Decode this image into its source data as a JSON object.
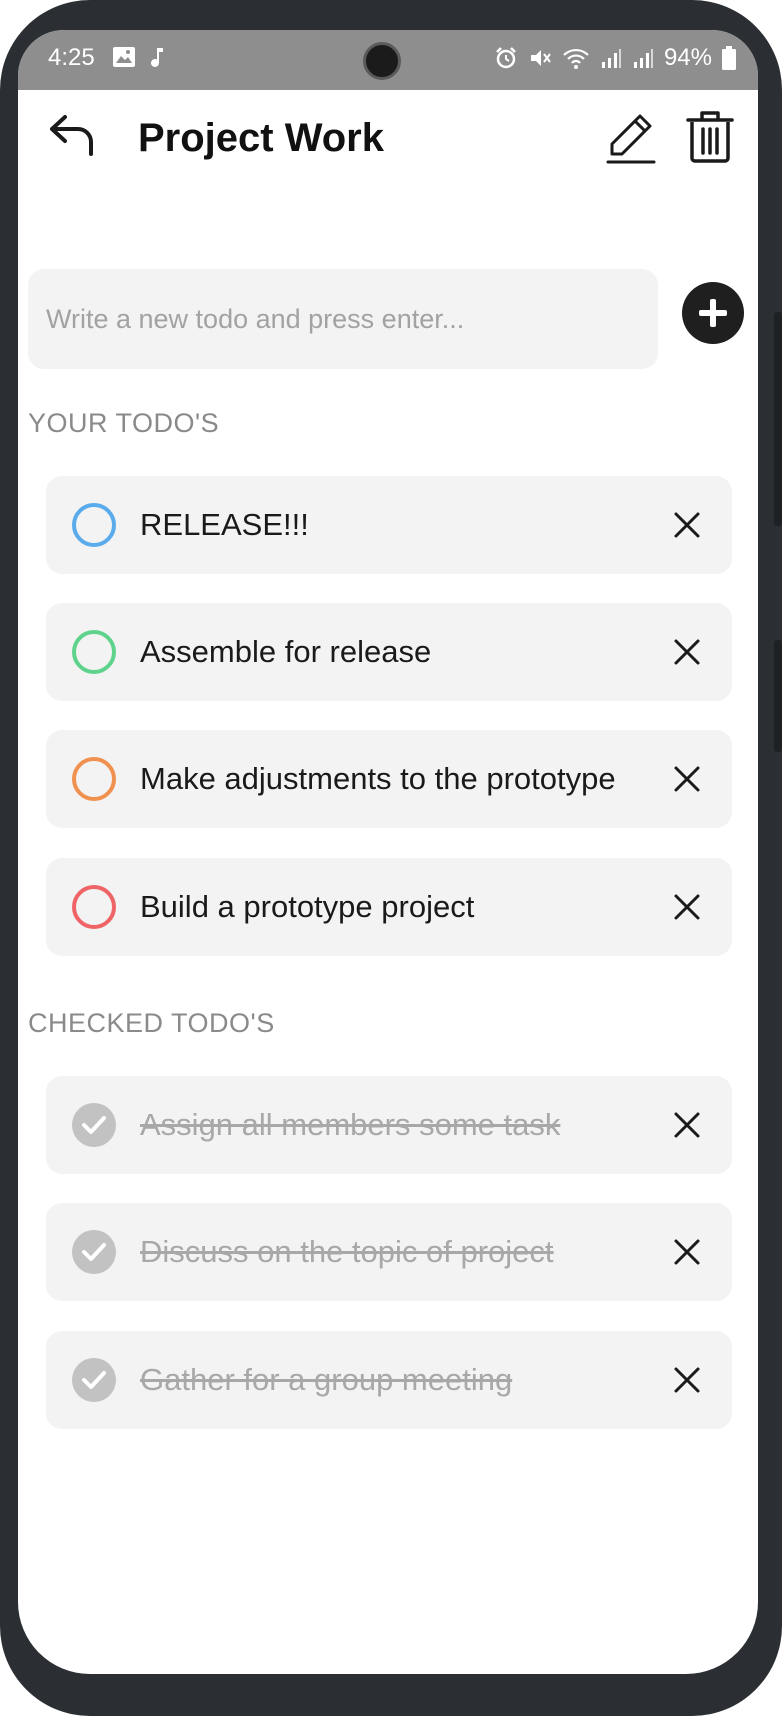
{
  "status_bar": {
    "time": "4:25",
    "battery": "94%"
  },
  "header": {
    "title": "Project Work"
  },
  "new_todo": {
    "placeholder": "Write a new todo and press enter..."
  },
  "sections": {
    "open_label": "YOUR TODO'S",
    "checked_label": "CHECKED TODO'S"
  },
  "open_todos": [
    {
      "text": "RELEASE!!!",
      "color": "#5aabec"
    },
    {
      "text": "Assemble for release",
      "color": "#5fd38c"
    },
    {
      "text": "Make adjustments to the prototype",
      "color": "#f09150"
    },
    {
      "text": "Build a prototype project",
      "color": "#ef6466"
    }
  ],
  "checked_todos": [
    {
      "text": "Assign all members some task"
    },
    {
      "text": "Discuss on the topic of project"
    },
    {
      "text": "Gather for a group meeting"
    }
  ],
  "colors": {
    "status_bar_bg": "#8e8e8e",
    "item_bg": "#f3f3f3",
    "checked_circle": "#c2c2c2"
  }
}
